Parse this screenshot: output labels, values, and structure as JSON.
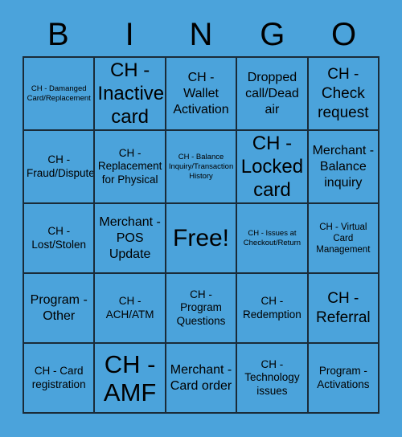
{
  "header": {
    "letters": [
      "B",
      "I",
      "N",
      "G",
      "O"
    ]
  },
  "grid": {
    "rows": [
      [
        {
          "text": "CH - Damanged Card/Replacement",
          "size": "fs-xs"
        },
        {
          "text": "CH - Inactive card",
          "size": "fs-xxl"
        },
        {
          "text": "CH - Wallet Activation",
          "size": "fs-l"
        },
        {
          "text": "Dropped call/Dead air",
          "size": "fs-l"
        },
        {
          "text": "CH - Check request",
          "size": "fs-xl"
        }
      ],
      [
        {
          "text": "CH - Fraud/Dispute",
          "size": "fs-m"
        },
        {
          "text": "CH - Replacement for Physical",
          "size": "fs-m"
        },
        {
          "text": "CH - Balance Inquiry/Transaction History",
          "size": "fs-xs"
        },
        {
          "text": "CH - Locked card",
          "size": "fs-xxl"
        },
        {
          "text": "Merchant - Balance inquiry",
          "size": "fs-l"
        }
      ],
      [
        {
          "text": "CH - Lost/Stolen",
          "size": "fs-m"
        },
        {
          "text": "Merchant - POS Update",
          "size": "fs-l"
        },
        {
          "text": "Free!",
          "size": "fs-free"
        },
        {
          "text": "CH - Issues at Checkout/Return",
          "size": "fs-xs"
        },
        {
          "text": "CH - Virtual Card Management",
          "size": "fs-s"
        }
      ],
      [
        {
          "text": "Program - Other",
          "size": "fs-l"
        },
        {
          "text": "CH - ACH/ATM",
          "size": "fs-m"
        },
        {
          "text": "CH - Program Questions",
          "size": "fs-m"
        },
        {
          "text": "CH - Redemption",
          "size": "fs-m"
        },
        {
          "text": "CH - Referral",
          "size": "fs-xl"
        }
      ],
      [
        {
          "text": "CH - Card registration",
          "size": "fs-m"
        },
        {
          "text": "CH - AMF",
          "size": "fs-amf"
        },
        {
          "text": "Merchant - Card order",
          "size": "fs-l"
        },
        {
          "text": "CH - Technology issues",
          "size": "fs-m"
        },
        {
          "text": "Program - Activations",
          "size": "fs-m"
        }
      ]
    ]
  },
  "colors": {
    "background": "#4ba3db",
    "border": "#1a2b38",
    "text": "#000000"
  }
}
